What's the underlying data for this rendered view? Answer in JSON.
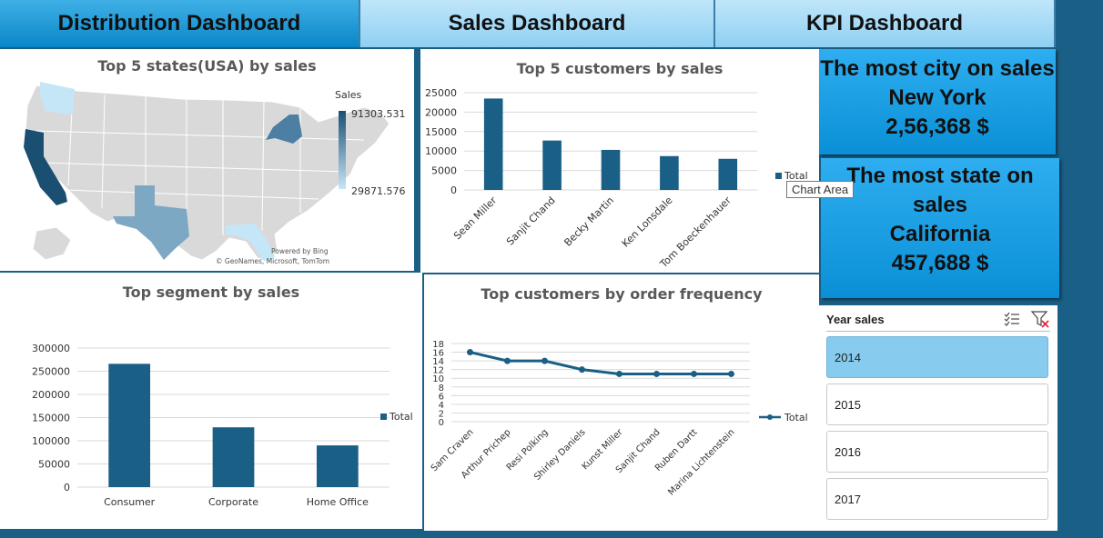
{
  "tabs": [
    {
      "label": "Distribution Dashboard"
    },
    {
      "label": "Sales Dashboard"
    },
    {
      "label": "KPI Dashboard"
    }
  ],
  "map_panel": {
    "title": "Top 5 states(USA) by sales",
    "legend_title": "Sales",
    "legend_max": "91303.531",
    "legend_min": "29871.576",
    "credit1": "Powered by Bing",
    "credit2": "© GeoNames, Microsoft, TomTom",
    "colors": {
      "high": "#1b4f72",
      "low": "#c5e6f7"
    }
  },
  "kpi": {
    "city_title": "The most city on sales",
    "city_name": "New York",
    "city_value": "2,56,368  $",
    "state_title_1": "The most state on",
    "state_title_2": "sales",
    "state_name": "California",
    "state_value": "457,688 $"
  },
  "tooltip": "Chart Area",
  "slicer": {
    "title": "Year sales",
    "items": [
      {
        "label": "2014",
        "selected": true
      },
      {
        "label": "2015",
        "selected": false
      },
      {
        "label": "2016",
        "selected": false
      },
      {
        "label": "2017",
        "selected": false
      }
    ]
  },
  "chart_data": [
    {
      "type": "bar",
      "title": "Top 5 customers by sales",
      "categories": [
        "Sean Miller",
        "Sanjit Chand",
        "Becky Martin",
        "Ken Lonsdale",
        "Tom Boeckenhauer"
      ],
      "series": [
        {
          "name": "Total",
          "values": [
            23500,
            12700,
            10300,
            8700,
            8000
          ]
        }
      ],
      "yticks": [
        0,
        5000,
        10000,
        15000,
        20000,
        25000
      ],
      "ylim": [
        0,
        25000
      ],
      "legend": "right",
      "color": "#1a5f86"
    },
    {
      "type": "bar",
      "title": "Top segment by sales",
      "categories": [
        "Consumer",
        "Corporate",
        "Home Office"
      ],
      "series": [
        {
          "name": "Total",
          "values": [
            266000,
            129000,
            90000
          ]
        }
      ],
      "yticks": [
        0,
        50000,
        100000,
        150000,
        200000,
        250000,
        300000
      ],
      "ylim": [
        0,
        300000
      ],
      "legend": "right",
      "color": "#1a5f86"
    },
    {
      "type": "line",
      "title": "Top customers by order frequency",
      "categories": [
        "Sam Craven",
        "Arthur Prichep",
        "Resi Polking",
        "Shirley Daniels",
        "Kunst Miller",
        "Sanjit Chand",
        "Ruben Dartt",
        "Marina Lichtenstein"
      ],
      "series": [
        {
          "name": "Total",
          "values": [
            16,
            14,
            14,
            12,
            11,
            11,
            11,
            11
          ]
        }
      ],
      "yticks": [
        0,
        2,
        4,
        6,
        8,
        10,
        12,
        14,
        16,
        18
      ],
      "ylim": [
        0,
        18
      ],
      "legend": "right",
      "color": "#1a5f86"
    }
  ]
}
